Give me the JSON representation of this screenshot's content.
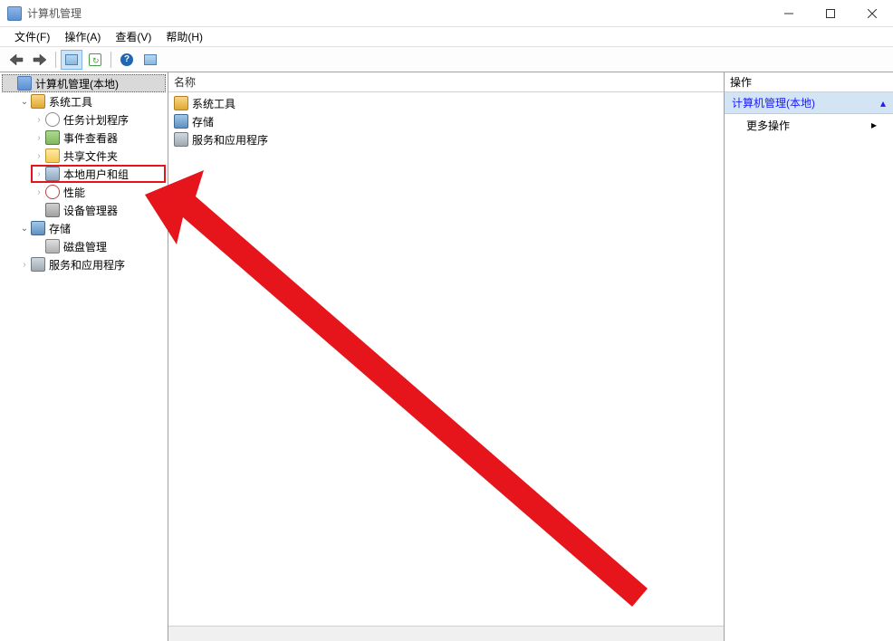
{
  "titlebar": {
    "title": "计算机管理"
  },
  "menubar": {
    "file": "文件(F)",
    "action": "操作(A)",
    "view": "查看(V)",
    "help": "帮助(H)"
  },
  "tree": {
    "root": "计算机管理(本地)",
    "system_tools": {
      "label": "系统工具",
      "task_scheduler": "任务计划程序",
      "event_viewer": "事件查看器",
      "shared_folders": "共享文件夹",
      "local_users": "本地用户和组",
      "performance": "性能",
      "device_manager": "设备管理器"
    },
    "storage": {
      "label": "存储",
      "disk_mgmt": "磁盘管理"
    },
    "services_apps": "服务和应用程序"
  },
  "list": {
    "header": "名称",
    "items": {
      "system_tools": "系统工具",
      "storage": "存储",
      "services_apps": "服务和应用程序"
    }
  },
  "actions": {
    "header": "操作",
    "section": "计算机管理(本地)",
    "more": "更多操作"
  }
}
